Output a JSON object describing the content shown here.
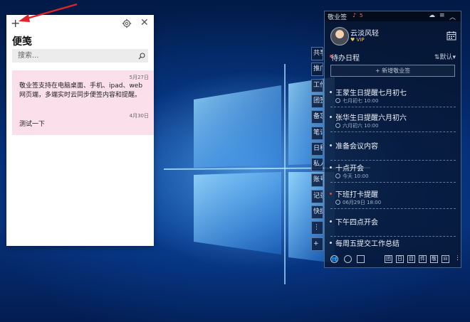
{
  "notes_app": {
    "add_label": "+",
    "close_label": "✕",
    "title": "便笺",
    "search_placeholder": "搜索...",
    "notes": [
      {
        "date": "5月27日",
        "text": "敬业签支持在电脑桌面、手机、ipad、web网页端，多端实时云同步便签内容和提醒。"
      },
      {
        "date": "4月30日",
        "text": "测试一下"
      }
    ]
  },
  "side_tabs": [
    "共享",
    "推广",
    "工作",
    "团签",
    "备忘",
    "笔记",
    "日程",
    "私人",
    "账号",
    "记录",
    "快捷",
    "⋮",
    "+"
  ],
  "todo_app": {
    "app_name": "敬业签",
    "notify_count": "5",
    "user_name": "云淡风轻",
    "vip_label": "VIP",
    "section_title": "待办日程",
    "sort_label": "默认",
    "new_button": "+ 新增敬业签",
    "items": [
      {
        "title": "王蒙生日提醒七月初七",
        "sub": "七月初七 10:00",
        "red": false
      },
      {
        "title": "张华生日提醒六月初六",
        "sub": "六月初六 10:00",
        "red": false
      },
      {
        "title": "准备会议内容",
        "sub": "",
        "red": false
      },
      {
        "title": "十点开会",
        "sub": "今天 10:00",
        "red": false
      },
      {
        "title": "下班打卡提醒",
        "sub": "06月29日 18:00",
        "red": true
      },
      {
        "title": "下午四点开会",
        "sub": "",
        "red": false
      },
      {
        "title": "每周五提交工作总结",
        "sub": "",
        "red": false
      }
    ],
    "footer_tabs": [
      "团",
      "日",
      "目",
      "件",
      "敬",
      "⊟"
    ]
  },
  "colors": {
    "annotation_arrow": "#e0242a",
    "note_bg": "#fbdfea",
    "widget_bg": "#081630",
    "desktop_blue": "#07307a"
  }
}
